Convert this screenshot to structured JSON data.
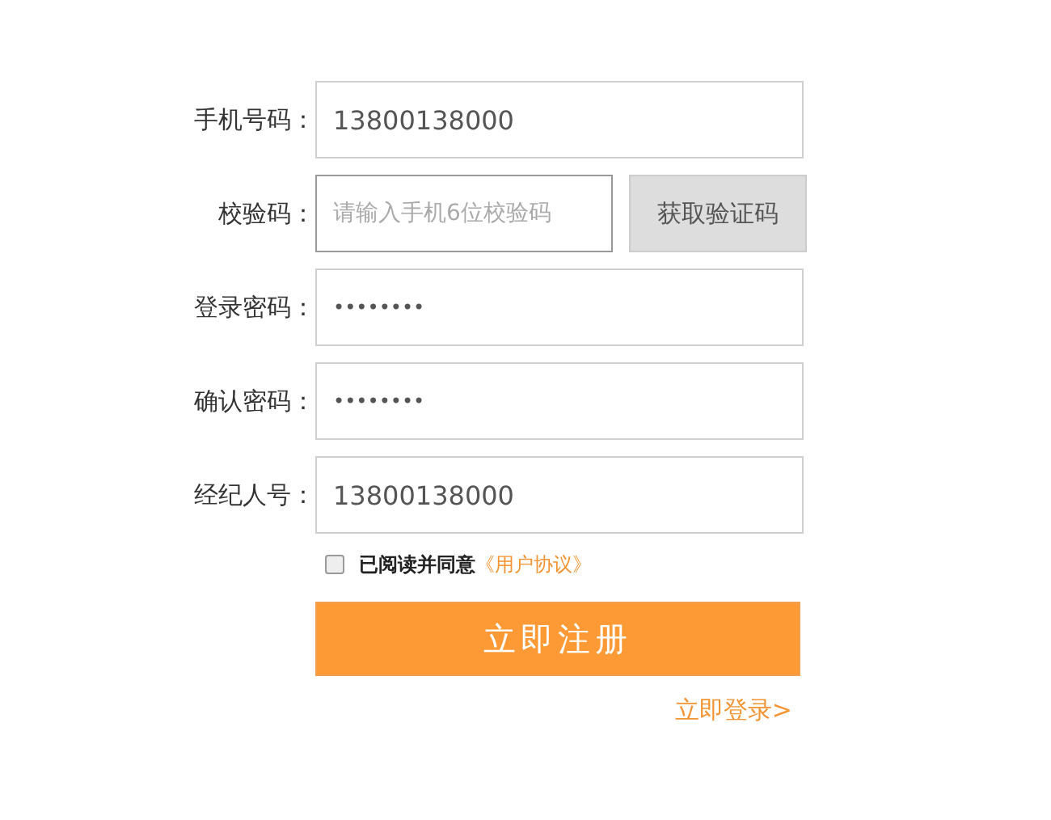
{
  "fields": [
    {
      "label": "手机号码：",
      "kind": "text",
      "value": "13800138000"
    },
    {
      "label": "校验码：",
      "kind": "code",
      "placeholder": "请输入手机6位校验码",
      "button": "获取验证码"
    },
    {
      "label": "登录密码：",
      "kind": "password",
      "value": "••••••••"
    },
    {
      "label": "确认密码：",
      "kind": "password",
      "value": "••••••••"
    },
    {
      "label": "经纪人号：",
      "kind": "text",
      "value": "13800138000"
    }
  ],
  "agreement": {
    "checked": false,
    "text": "已阅读并同意",
    "link": "《用户协议》"
  },
  "submit": "立即注册",
  "login_link": "立即登录>"
}
